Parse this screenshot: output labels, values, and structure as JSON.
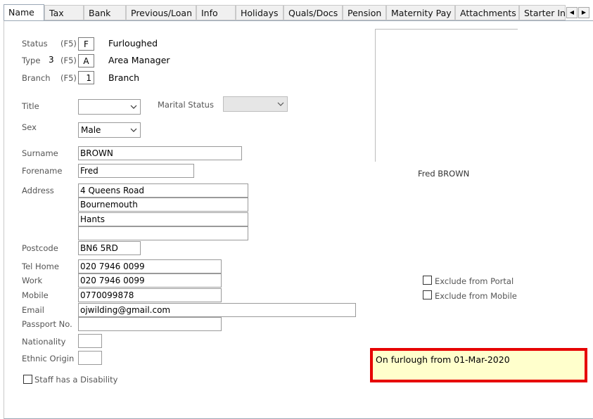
{
  "tabs": [
    {
      "label": "Name",
      "active": true
    },
    {
      "label": "Tax"
    },
    {
      "label": "Bank"
    },
    {
      "label": "Previous/Loan"
    },
    {
      "label": "Info"
    },
    {
      "label": "Holidays"
    },
    {
      "label": "Quals/Docs"
    },
    {
      "label": "Pension"
    },
    {
      "label": "Maternity Pay"
    },
    {
      "label": "Attachments"
    },
    {
      "label": "Starter Info"
    }
  ],
  "tab_scroll": {
    "left": "◀",
    "right": "▶"
  },
  "status": {
    "label": "Status",
    "key": "(F5)",
    "code": "F",
    "desc": "Furloughed"
  },
  "type": {
    "label": "Type",
    "num": "3",
    "key": "(F5)",
    "code": "A",
    "desc": "Area Manager"
  },
  "branch": {
    "label": "Branch",
    "key": "(F5)",
    "code": "1",
    "desc": "Branch"
  },
  "title": {
    "label": "Title",
    "value": ""
  },
  "marital": {
    "label": "Marital Status",
    "value": ""
  },
  "sex": {
    "label": "Sex",
    "value": "Male"
  },
  "surname": {
    "label": "Surname",
    "value": "BROWN"
  },
  "forename": {
    "label": "Forename",
    "value": "Fred"
  },
  "address": {
    "label": "Address",
    "lines": [
      "4 Queens Road",
      "Bournemouth",
      "Hants",
      ""
    ]
  },
  "postcode": {
    "label": "Postcode",
    "value": "BN6 5RD"
  },
  "tel_home": {
    "label": "Tel Home",
    "value": "020 7946 0099"
  },
  "work": {
    "label": "Work",
    "value": "020 7946 0099"
  },
  "mobile": {
    "label": "Mobile",
    "value": "0770099878"
  },
  "email": {
    "label": "Email",
    "value": "ojwilding@gmail.com"
  },
  "passport": {
    "label": "Passport No.",
    "value": ""
  },
  "nationality": {
    "label": "Nationality",
    "value": ""
  },
  "ethnic": {
    "label": "Ethnic Origin",
    "value": ""
  },
  "disability": {
    "label": "Staff has a Disability",
    "checked": false
  },
  "photo_caption": "Fred BROWN",
  "exclude_portal": {
    "label": "Exclude from Portal",
    "checked": false
  },
  "exclude_mobile": {
    "label": "Exclude from Mobile",
    "checked": false
  },
  "note": "On furlough from 01-Mar-2020",
  "colors": {
    "highlight_border": "#e60000",
    "note_bg": "#ffffcc",
    "active_tab_border": "#9aa7b5"
  }
}
